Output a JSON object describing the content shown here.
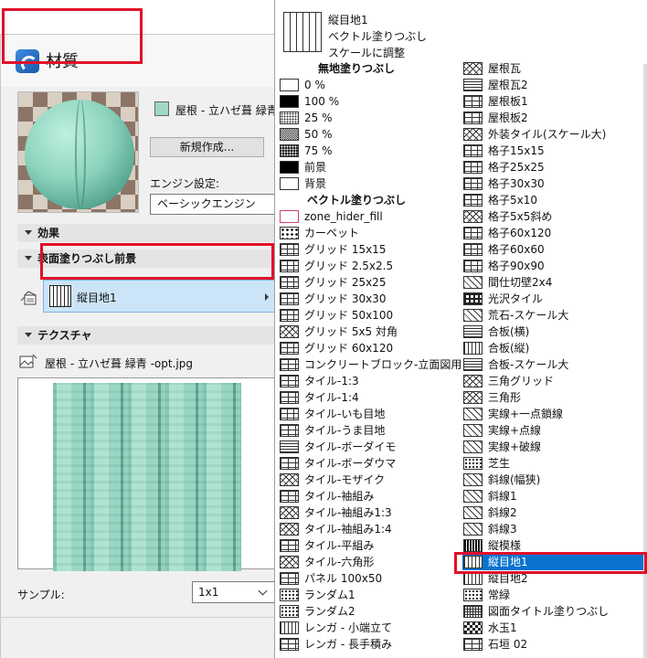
{
  "dialog": {
    "title": "材質",
    "material_name": "屋根 - 立ハゼ葺 緑青",
    "new_button": "新規作成...",
    "engine_label": "エンジン設定:",
    "engine_value": "ベーシックエンジン",
    "sections": {
      "effects": "効果",
      "surface_fill": "表面塗りつぶし前景",
      "texture": "テクスチャ"
    },
    "surface_fill_value": "縦目地1",
    "texture_file": "屋根 - 立ハゼ葺 緑青 -opt.jpg",
    "sample_label": "サンプル:",
    "sample_value": "1x1",
    "colors": {
      "swatch": "#9fd8c3",
      "highlight": "#e0102a",
      "selected": "#0a73d0"
    }
  },
  "dropdown": {
    "header": {
      "name": "縦目地1",
      "type": "ベクトル塗りつぶし",
      "scale": "スケールに調整"
    },
    "left_column": [
      {
        "label": "無地塗りつぶし",
        "header": true
      },
      {
        "label": "0 %",
        "pattern": "empty"
      },
      {
        "label": "100 %",
        "pattern": "black"
      },
      {
        "label": "25 %",
        "pattern": "25"
      },
      {
        "label": "50 %",
        "pattern": "50"
      },
      {
        "label": "75 %",
        "pattern": "75"
      },
      {
        "label": "前景",
        "pattern": "black"
      },
      {
        "label": "背景",
        "pattern": "empty"
      },
      {
        "label": "ベクトル塗りつぶし",
        "header": true
      },
      {
        "label": "zone_hider_fill",
        "pattern": "zone"
      },
      {
        "label": "カーペット",
        "pattern": "carpet"
      },
      {
        "label": "グリッド 15x15",
        "pattern": "grid"
      },
      {
        "label": "グリッド 2.5x2.5",
        "pattern": "grid"
      },
      {
        "label": "グリッド 25x25",
        "pattern": "grid"
      },
      {
        "label": "グリッド 30x30",
        "pattern": "grid"
      },
      {
        "label": "グリッド 50x100",
        "pattern": "grid"
      },
      {
        "label": "グリッド 5x5 対角",
        "pattern": "cross"
      },
      {
        "label": "グリッド 60x120",
        "pattern": "grid"
      },
      {
        "label": "コンクリートブロック-立面図用",
        "pattern": "brick"
      },
      {
        "label": "タイル-1:3",
        "pattern": "brick"
      },
      {
        "label": "タイル-1:4",
        "pattern": "brick"
      },
      {
        "label": "タイル-いも目地",
        "pattern": "grid"
      },
      {
        "label": "タイル-うま目地",
        "pattern": "brick"
      },
      {
        "label": "タイル-ボーダイモ",
        "pattern": "hlines"
      },
      {
        "label": "タイル-ボーダウマ",
        "pattern": "brick"
      },
      {
        "label": "タイル-モザイク",
        "pattern": "cross"
      },
      {
        "label": "タイル-袖組み",
        "pattern": "brick"
      },
      {
        "label": "タイル-袖組み1:3",
        "pattern": "cross"
      },
      {
        "label": "タイル-袖組み1:4",
        "pattern": "cross"
      },
      {
        "label": "タイル-平組み",
        "pattern": "brick"
      },
      {
        "label": "タイル-六角形",
        "pattern": "cross"
      },
      {
        "label": "パネル 100x50",
        "pattern": "brick"
      },
      {
        "label": "ランダム1",
        "pattern": "dots"
      },
      {
        "label": "ランダム2",
        "pattern": "dots"
      },
      {
        "label": "レンガ - 小端立て",
        "pattern": "vlines"
      },
      {
        "label": "レンガ - 長手積み",
        "pattern": "brick"
      }
    ],
    "right_column": [
      {
        "label": "屋根瓦",
        "pattern": "cross"
      },
      {
        "label": "屋根瓦2",
        "pattern": "hlines"
      },
      {
        "label": "屋根板1",
        "pattern": "brick"
      },
      {
        "label": "屋根板2",
        "pattern": "brick"
      },
      {
        "label": "外装タイル(スケール大)",
        "pattern": "cross"
      },
      {
        "label": "格子15x15",
        "pattern": "grid"
      },
      {
        "label": "格子25x25",
        "pattern": "grid"
      },
      {
        "label": "格子30x30",
        "pattern": "grid"
      },
      {
        "label": "格子5x10",
        "pattern": "grid"
      },
      {
        "label": "格子5x5斜め",
        "pattern": "cross"
      },
      {
        "label": "格子60x120",
        "pattern": "grid"
      },
      {
        "label": "格子60x60",
        "pattern": "grid"
      },
      {
        "label": "格子90x90",
        "pattern": "grid"
      },
      {
        "label": "間仕切壁2x4",
        "pattern": "diag"
      },
      {
        "label": "光沢タイル",
        "pattern": "tile"
      },
      {
        "label": "荒石-スケール大",
        "pattern": "diag"
      },
      {
        "label": "合板(横)",
        "pattern": "hlines"
      },
      {
        "label": "合板(縦)",
        "pattern": "vlines"
      },
      {
        "label": "合板-スケール大",
        "pattern": "hlines"
      },
      {
        "label": "三角グリッド",
        "pattern": "cross"
      },
      {
        "label": "三角形",
        "pattern": "cross"
      },
      {
        "label": "実線+一点鎖線",
        "pattern": "diag"
      },
      {
        "label": "実線+点線",
        "pattern": "diag"
      },
      {
        "label": "実線+破線",
        "pattern": "diag"
      },
      {
        "label": "芝生",
        "pattern": "dots"
      },
      {
        "label": "斜線(幅狭)",
        "pattern": "diag"
      },
      {
        "label": "斜線1",
        "pattern": "diag"
      },
      {
        "label": "斜線2",
        "pattern": "diag"
      },
      {
        "label": "斜線3",
        "pattern": "diag"
      },
      {
        "label": "縦模様",
        "pattern": "vdense"
      },
      {
        "label": "縦目地1",
        "pattern": "vlines",
        "selected": true
      },
      {
        "label": "縦目地2",
        "pattern": "vlines"
      },
      {
        "label": "常緑",
        "pattern": "dots"
      },
      {
        "label": "図面タイトル塗りつぶし",
        "pattern": "finegrid"
      },
      {
        "label": "水玉1",
        "pattern": "check"
      },
      {
        "label": "石垣 02",
        "pattern": "brick"
      }
    ]
  }
}
